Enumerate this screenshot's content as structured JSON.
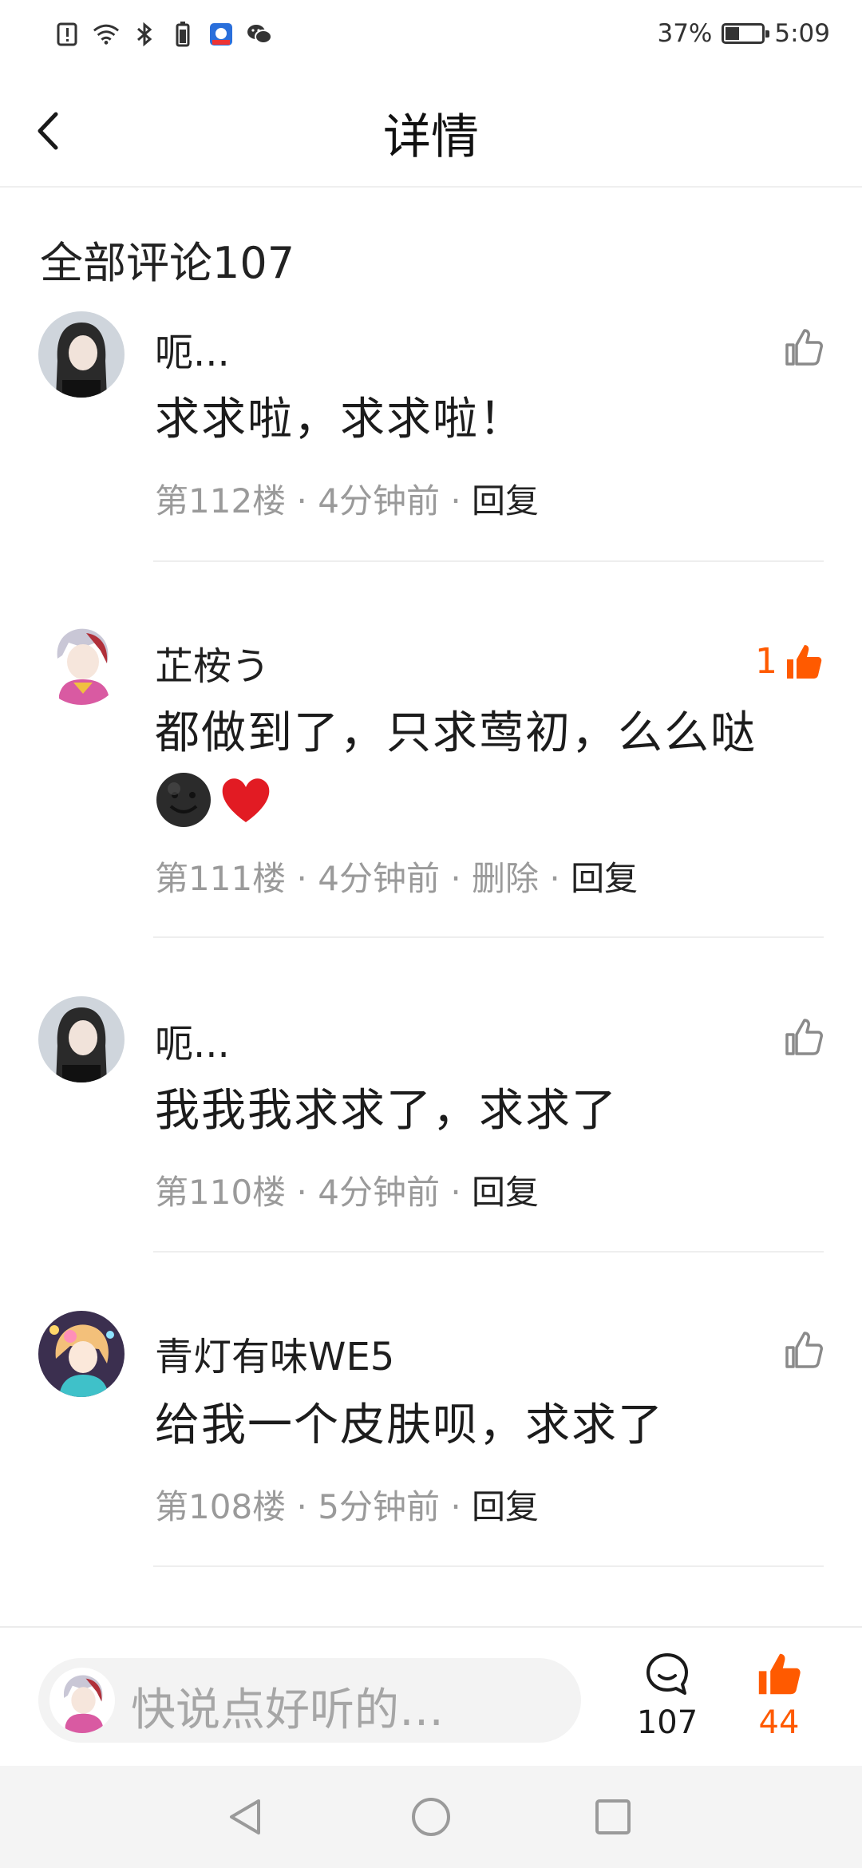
{
  "status_bar": {
    "battery": "37%",
    "time": "5:09",
    "battery_level": 0.37
  },
  "header": {
    "title": "详情"
  },
  "comments_section": {
    "title": "全部评论107"
  },
  "comments": [
    {
      "user": "呃...",
      "text": "求求啦，求求啦！",
      "floor": "第112楼",
      "time": "4分钟前",
      "reply": "回复",
      "likes": ""
    },
    {
      "user": "芷桉う",
      "text": "都做到了，只求莺初，么么哒",
      "floor": "第111楼",
      "time": "4分钟前",
      "delete": "删除",
      "reply": "回复",
      "likes": "1"
    },
    {
      "user": "呃...",
      "text": "我我我求求了，求求了",
      "floor": "第110楼",
      "time": "4分钟前",
      "reply": "回复",
      "likes": ""
    },
    {
      "user": "青灯有味WE5",
      "text": "给我一个皮肤呗，求求了",
      "floor": "第108楼",
      "time": "5分钟前",
      "reply": "回复",
      "likes": ""
    }
  ],
  "bottom_bar": {
    "input_placeholder": "快说点好听的…",
    "comment_count": "107",
    "like_count": "44"
  },
  "colors": {
    "accent": "#ff5a00",
    "muted": "#9a9a9a"
  },
  "icons": [
    "alert-icon",
    "wifi-icon",
    "bluetooth-icon",
    "battery-small-icon",
    "baidu-icon",
    "wechat-icon",
    "back-arrow-icon",
    "thumbs-up-icon",
    "comment-bubble-icon",
    "nav-back-icon",
    "nav-home-icon",
    "nav-recent-icon"
  ]
}
